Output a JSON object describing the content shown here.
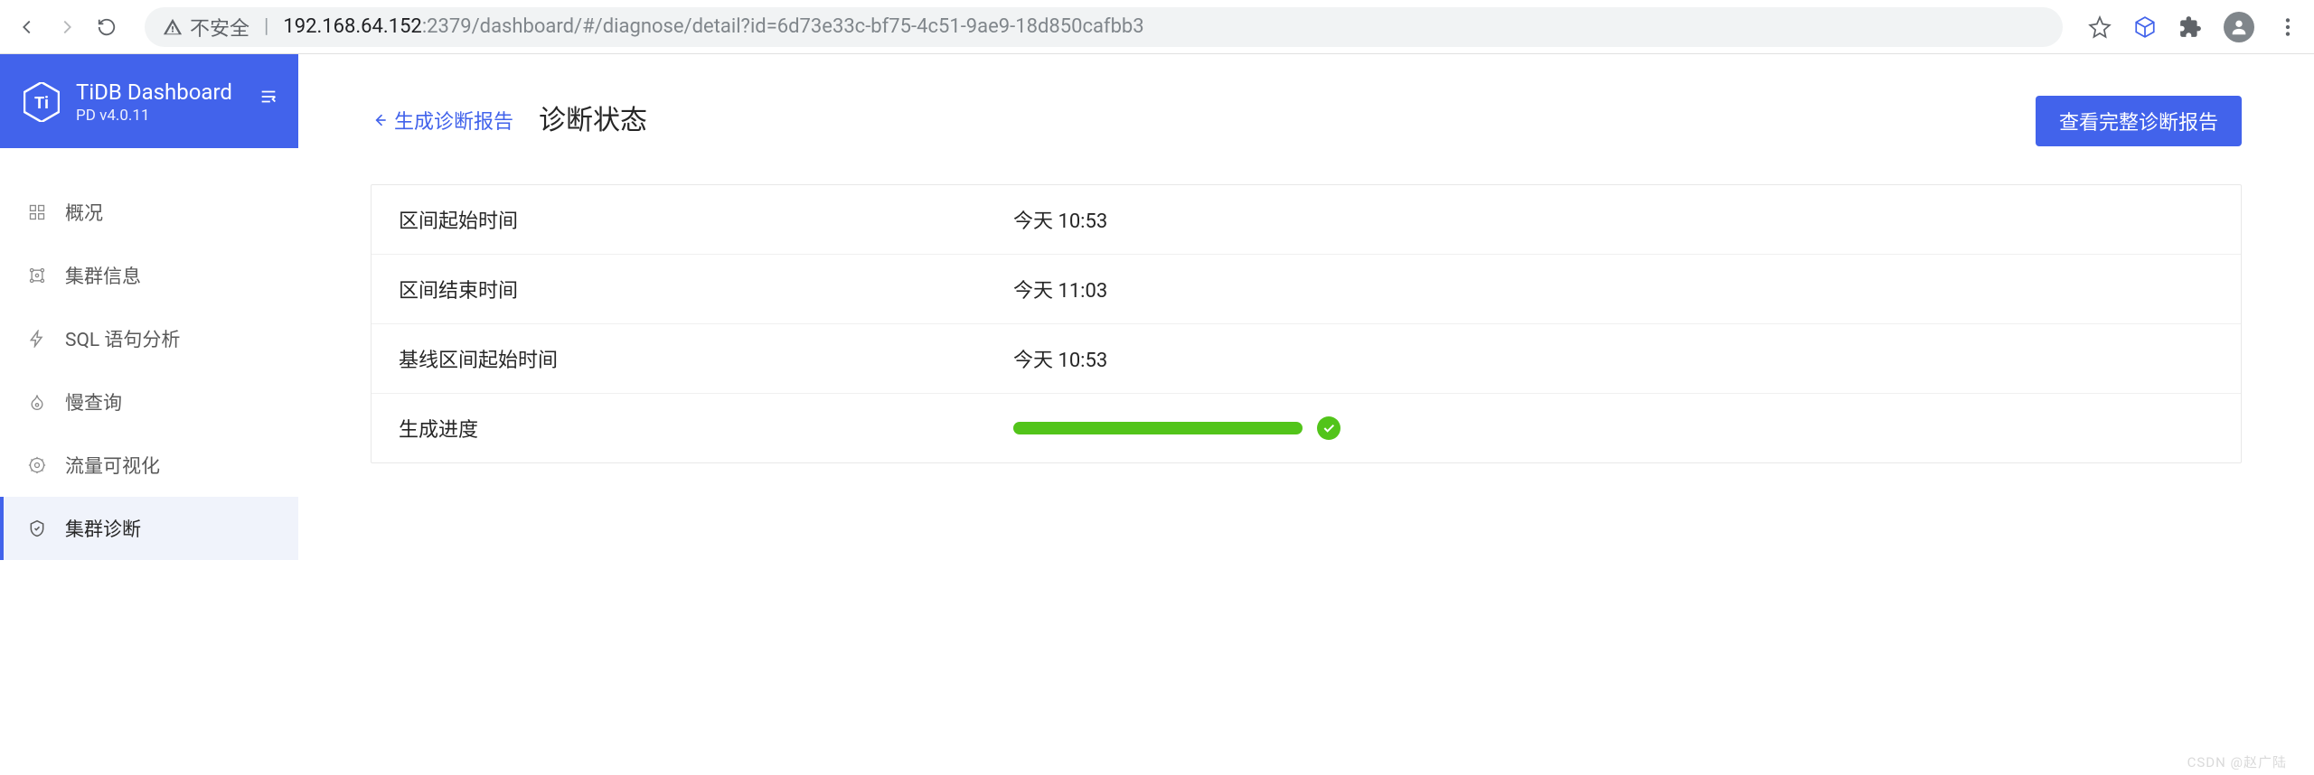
{
  "browser": {
    "security_label": "不安全",
    "host": "192.168.64.152",
    "port_path": ":2379/dashboard/#/diagnose/detail?id=6d73e33c-bf75-4c51-9ae9-18d850cafbb3"
  },
  "sidebar": {
    "brand_title": "TiDB Dashboard",
    "brand_sub": "PD v4.0.11",
    "items": [
      {
        "label": "概况",
        "icon": "overview-icon",
        "active": false
      },
      {
        "label": "集群信息",
        "icon": "cluster-info-icon",
        "active": false
      },
      {
        "label": "SQL 语句分析",
        "icon": "sql-analysis-icon",
        "active": false
      },
      {
        "label": "慢查询",
        "icon": "slow-query-icon",
        "active": false
      },
      {
        "label": "流量可视化",
        "icon": "traffic-viz-icon",
        "active": false
      },
      {
        "label": "集群诊断",
        "icon": "diagnose-icon",
        "active": true
      }
    ]
  },
  "header": {
    "back_label": "生成诊断报告",
    "title": "诊断状态",
    "view_full_label": "查看完整诊断报告"
  },
  "rows": [
    {
      "label": "区间起始时间",
      "value": "今天 10:53"
    },
    {
      "label": "区间结束时间",
      "value": "今天 11:03"
    },
    {
      "label": "基线区间起始时间",
      "value": "今天 10:53"
    },
    {
      "label": "生成进度",
      "value": ""
    }
  ],
  "progress": {
    "percent": 100,
    "status": "success"
  },
  "watermark": "CSDN @赵广陆"
}
